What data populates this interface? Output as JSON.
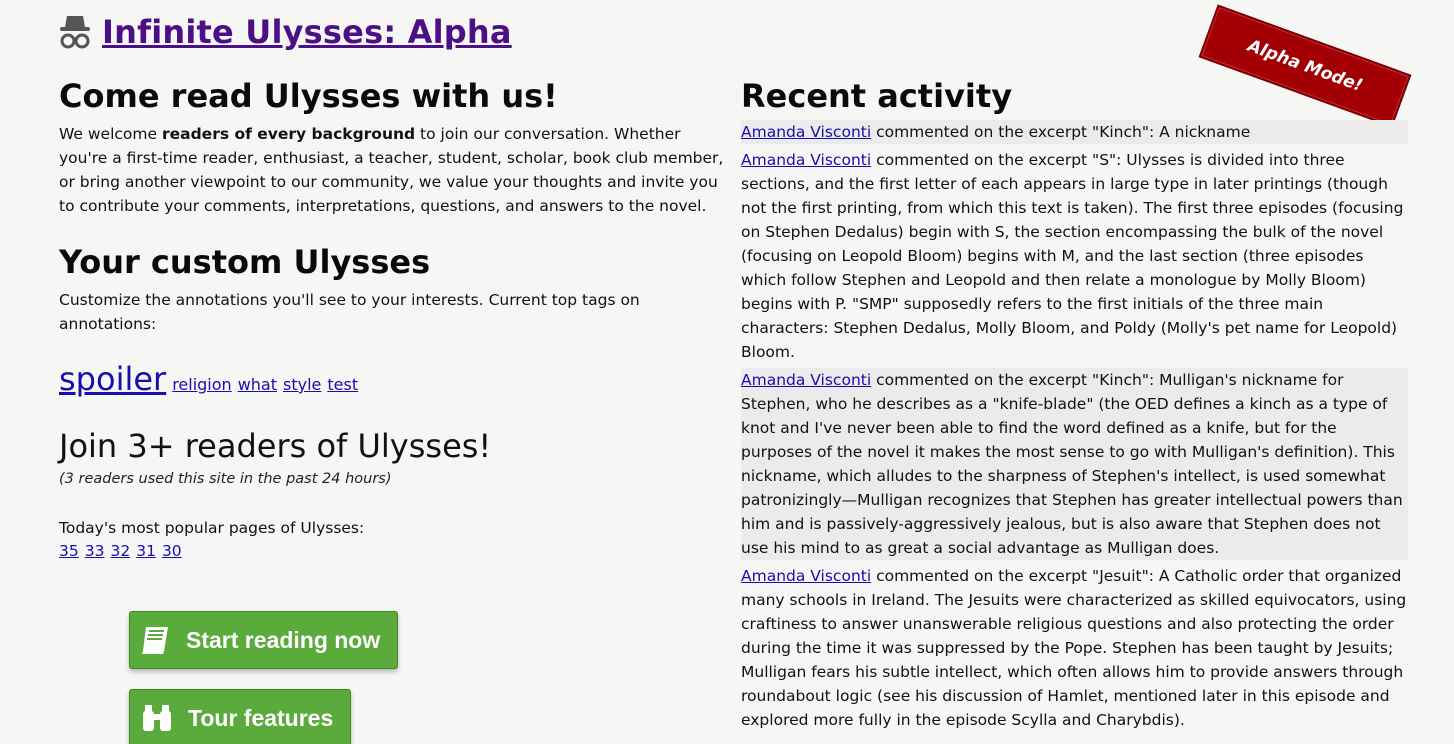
{
  "header": {
    "title": "Infinite Ulysses: Alpha",
    "icon": "incognito-icon"
  },
  "ribbon": {
    "label": "Alpha Mode!",
    "color": "#a30006"
  },
  "intro": {
    "heading": "Come read Ulysses with us!",
    "text_before": "We welcome ",
    "text_bold": "readers of every background",
    "text_after": " to join our conversation. Whether you're a first-time reader, enthusiast, a teacher, student, scholar, book club member, or bring another viewpoint to our community, we value your thoughts and invite you to contribute your comments, interpretations, questions, and answers to the novel."
  },
  "custom": {
    "heading": "Your custom Ulysses",
    "text": "Customize the annotations you'll see to your interests. Current top tags on annotations:",
    "tags": [
      "spoiler",
      "religion",
      "what",
      "style",
      "test"
    ]
  },
  "join": {
    "heading": "Join 3+ readers of Ulysses!",
    "sub": "(3 readers used this site in the past 24 hours)"
  },
  "popular": {
    "label": "Today's most popular pages of Ulysses:",
    "pages": [
      "35",
      "33",
      "32",
      "31",
      "30"
    ]
  },
  "buttons": {
    "start": "Start reading now",
    "tour": "Tour features",
    "color": "#5aab3c"
  },
  "activity": {
    "heading": "Recent activity",
    "items": [
      {
        "user": "Amanda Visconti",
        "text": " commented on the excerpt \"Kinch\": A nickname"
      },
      {
        "user": "Amanda Visconti",
        "text": " commented on the excerpt \"S\": Ulysses is divided into three sections, and the first letter of each appears in large type in later printings (though not the first printing, from which this text is taken). The first three episodes (focusing on Stephen Dedalus) begin with S, the section encompassing the bulk of the novel (focusing on Leopold Bloom) begins with M, and the last section (three episodes which follow Stephen and Leopold and then relate a monologue by Molly Bloom) begins with P. \"SMP\" supposedly refers to the first initials of the three main characters: Stephen Dedalus, Molly Bloom, and Poldy (Molly's pet name for Leopold) Bloom."
      },
      {
        "user": "Amanda Visconti",
        "text": " commented on the excerpt \"Kinch\": Mulligan's nickname for Stephen, who he describes as a \"knife-blade\" (the OED defines a kinch as a type of knot and I've never been able to find the word defined as a knife, but for the purposes of the novel it makes the most sense to go with Mulligan's definition). This nickname, which alludes to the sharpness of Stephen's intellect, is used somewhat patronizingly—Mulligan recognizes that Stephen has greater intellectual powers than him and is passively-aggressively jealous, but is also aware that Stephen does not use his mind to as great a social advantage as Mulligan does."
      },
      {
        "user": "Amanda Visconti",
        "text": " commented on the excerpt \"Jesuit\": A Catholic order that organized many schools in Ireland. The Jesuits were characterized as skilled equivocators, using craftiness to answer unanswerable religious questions and also protecting the order during the time it was suppressed by the Pope. Stephen has been taught by Jesuits; Mulligan fears his subtle intellect, which often allows him to provide answers through roundabout logic (see his discussion of Hamlet, mentioned later in this episode and explored more fully in the episode Scylla and Charybdis)."
      }
    ]
  }
}
